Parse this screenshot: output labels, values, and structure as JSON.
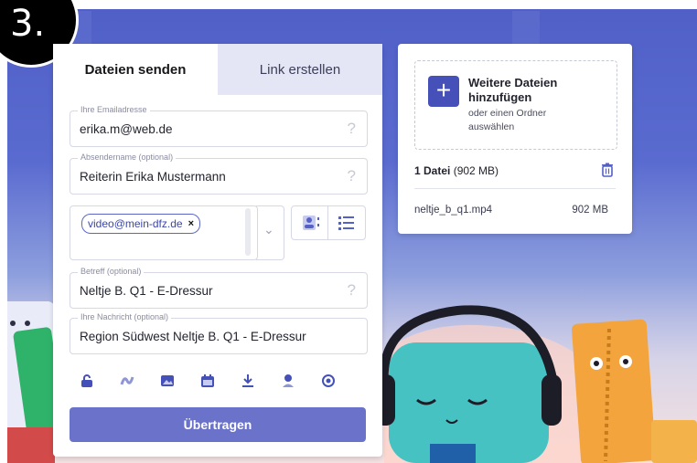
{
  "step": {
    "number": "3."
  },
  "tabs": {
    "send": "Dateien senden",
    "link": "Link erstellen"
  },
  "form": {
    "email": {
      "label": "Ihre Emailadresse",
      "value": "erika.m@web.de"
    },
    "sender": {
      "label": "Absendername (optional)",
      "value": "Reiterin Erika Mustermann"
    },
    "recipient": {
      "chip": "video@mein-dfz.de",
      "remove": "×"
    },
    "subject": {
      "label": "Betreff (optional)",
      "value": "Neltje B. Q1 - E-Dressur"
    },
    "message": {
      "label": "Ihre Nachricht (optional)",
      "value": "Region Südwest Neltje B. Q1 - E-Dressur"
    },
    "help": "?",
    "submit": "Übertragen"
  },
  "options_icons": [
    "lock-icon",
    "wave-icon",
    "image-icon",
    "calendar-icon",
    "download-icon",
    "person-icon",
    "eye-icon"
  ],
  "files": {
    "add_title": "Weitere Dateien hinzufügen",
    "add_sub": "oder einen Ordner auswählen",
    "count_bold": "1 Datei",
    "count_rest": " (902 MB)",
    "items": [
      {
        "name": "neltje_b_q1.mp4",
        "size": "902 MB"
      }
    ]
  },
  "colors": {
    "accent": "#4551b8",
    "button": "#6a72c9",
    "inactive_tab": "#e4e6f6"
  }
}
